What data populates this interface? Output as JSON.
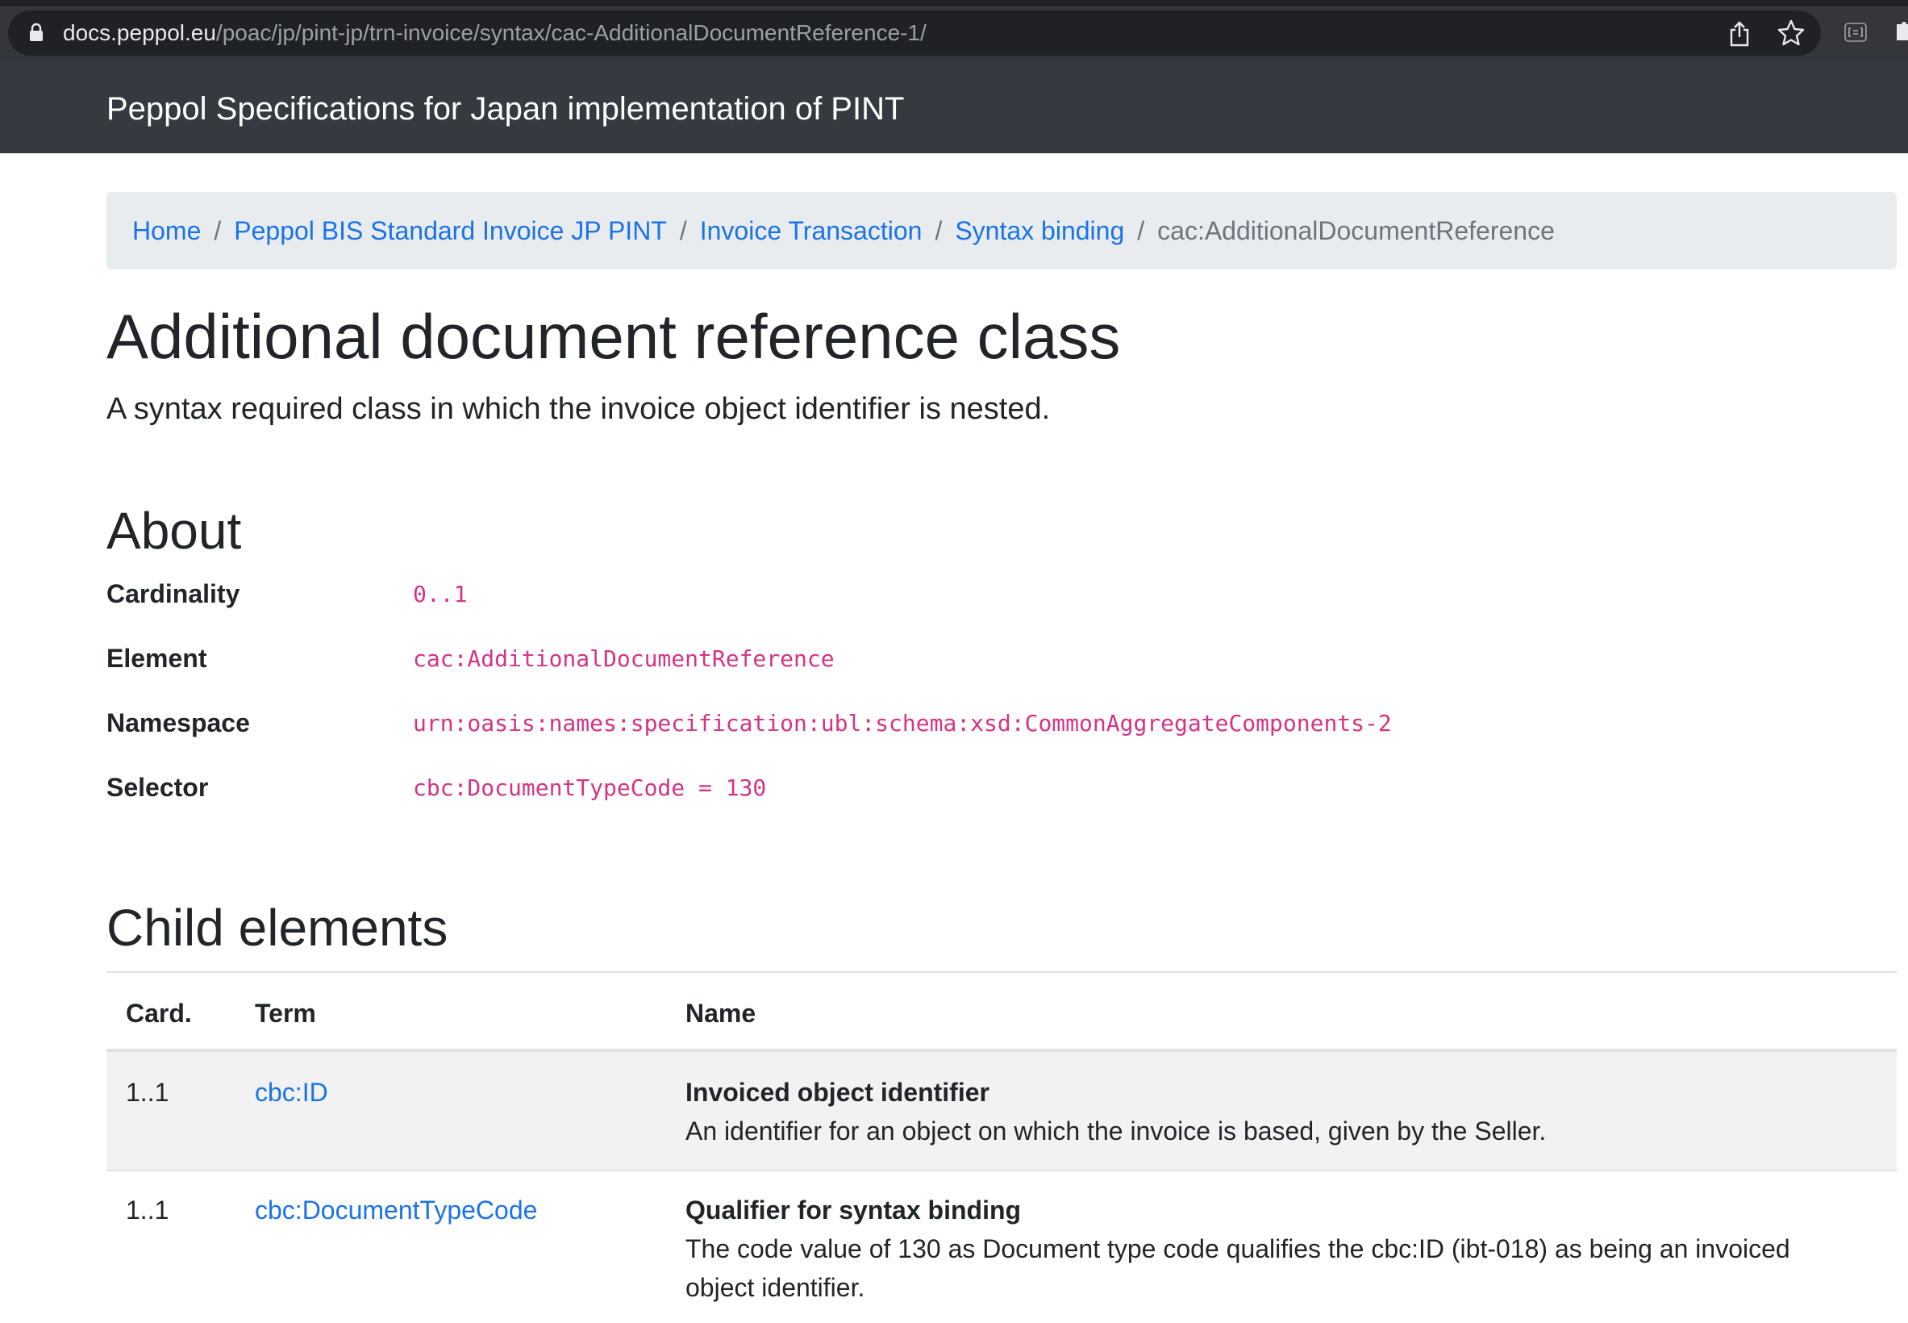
{
  "browser": {
    "url_host": "docs.peppol.eu",
    "url_path": "/poac/jp/pint-jp/trn-invoice/syntax/cac-AdditionalDocumentReference-1/"
  },
  "navbar": {
    "brand": "Peppol Specifications for Japan implementation of PINT"
  },
  "breadcrumb": {
    "items": [
      "Home",
      "Peppol BIS Standard Invoice JP PINT",
      "Invoice Transaction",
      "Syntax binding"
    ],
    "separator": "/",
    "current": "cac:AdditionalDocumentReference"
  },
  "page": {
    "title": "Additional document reference class",
    "lead": "A syntax required class in which the invoice object identifier is nested."
  },
  "about": {
    "heading": "About",
    "rows": [
      {
        "label": "Cardinality",
        "value": "0..1"
      },
      {
        "label": "Element",
        "value": "cac:AdditionalDocumentReference"
      },
      {
        "label": "Namespace",
        "value": "urn:oasis:names:specification:ubl:schema:xsd:CommonAggregateComponents-2"
      },
      {
        "label": "Selector",
        "value": "cbc:DocumentTypeCode = 130"
      }
    ]
  },
  "children": {
    "heading": "Child elements",
    "columns": [
      "Card.",
      "Term",
      "Name"
    ],
    "rows": [
      {
        "card": "1..1",
        "term": "cbc:ID",
        "name": "Invoiced object identifier",
        "description_lines": [
          "An identifier for an object on which the invoice is based, given by the Seller."
        ]
      },
      {
        "card": "1..1",
        "term": "cbc:DocumentTypeCode",
        "name": "Qualifier for syntax binding",
        "description_lines": [
          "The code value of 130 as Document type code qualifies the cbc:ID (ibt-018) as being an invoiced",
          "object identifier."
        ]
      }
    ]
  },
  "colors": {
    "link": "#1a73e8",
    "code": "#d63384",
    "navbar": "#343a40",
    "chrome": "#35363a"
  },
  "icons": [
    "lock-icon",
    "share-icon",
    "star-icon",
    "extension-icon",
    "puzzle-icon"
  ]
}
